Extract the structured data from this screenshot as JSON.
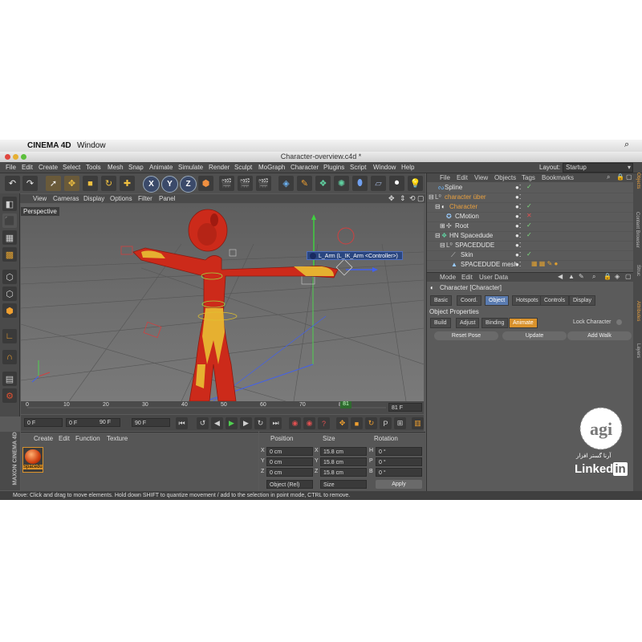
{
  "mac_menubar": {
    "apple": "",
    "app": "CINEMA 4D",
    "window": "Window"
  },
  "window": {
    "title": "Character-overview.c4d *"
  },
  "menu": [
    "File",
    "Edit",
    "Create",
    "Select",
    "Tools",
    "Mesh",
    "Snap",
    "Animate",
    "Simulate",
    "Render",
    "Sculpt",
    "MoGraph",
    "Character",
    "Plugins",
    "Script",
    "Window",
    "Help"
  ],
  "layout": {
    "label": "Layout:",
    "value": "Startup"
  },
  "viewport_menu": [
    "View",
    "Cameras",
    "Display",
    "Options",
    "Filter",
    "Panel"
  ],
  "viewport": {
    "name": "Perspective",
    "tooltip": "L_Arm (L_IK_Arm <Controller>)"
  },
  "timeline": {
    "ticks": [
      "0",
      "10",
      "20",
      "30",
      "40",
      "50",
      "60",
      "70",
      "80",
      "81 F"
    ],
    "current": "81"
  },
  "transport": {
    "start": "0 F",
    "min": "0 F",
    "max": "90 F",
    "end": "90 F"
  },
  "material_menu": [
    "Create",
    "Edit",
    "Function",
    "Texture"
  ],
  "material": {
    "name": "Spacedu"
  },
  "coords": {
    "headers": [
      "Position",
      "Size",
      "Rotation"
    ],
    "rows": [
      {
        "axis": "X",
        "pos": "0 cm",
        "size_axis": "X",
        "size": "15.8 cm",
        "rot_axis": "H",
        "rot": "0 °"
      },
      {
        "axis": "Y",
        "pos": "0 cm",
        "size_axis": "Y",
        "size": "15.8 cm",
        "rot_axis": "P",
        "rot": "0 °"
      },
      {
        "axis": "Z",
        "pos": "0 cm",
        "size_axis": "Z",
        "size": "15.8 cm",
        "rot_axis": "B",
        "rot": "0 °"
      }
    ],
    "mode": "Object (Rel)",
    "size_mode": "Size",
    "apply": "Apply"
  },
  "objects_menu": [
    "File",
    "Edit",
    "View",
    "Objects",
    "Tags",
    "Bookmarks"
  ],
  "objects": [
    {
      "name": "Spline",
      "indent": 1,
      "color": "#e4e4e4"
    },
    {
      "name": "character über",
      "indent": 0,
      "color": "#e8a040"
    },
    {
      "name": "Character",
      "indent": 1,
      "color": "#e8a040"
    },
    {
      "name": "CMotion",
      "indent": 2,
      "color": "#e4e4e4"
    },
    {
      "name": "Root",
      "indent": 2,
      "color": "#e4e4e4"
    },
    {
      "name": "HN Spacedude",
      "indent": 1,
      "color": "#e4e4e4"
    },
    {
      "name": "SPACEDUDE",
      "indent": 2,
      "color": "#e4e4e4"
    },
    {
      "name": "Skin",
      "indent": 3,
      "color": "#e4e4e4"
    },
    {
      "name": "SPACEDUDE mesh",
      "indent": 3,
      "color": "#e4e4e4"
    }
  ],
  "attributes_menu": [
    "Mode",
    "Edit",
    "User Data"
  ],
  "attributes": {
    "title": "Character [Character]",
    "tabs": [
      "Basic",
      "Coord.",
      "Object",
      "Hotspots",
      "Controls",
      "Display"
    ],
    "section": "Object Properties",
    "subtabs": [
      "Build",
      "Adjust",
      "Binding",
      "Animate"
    ],
    "lock_label": "Lock Character",
    "buttons": [
      "Reset Pose",
      "Update",
      "Add Walk"
    ]
  },
  "side_tabs": [
    "Objects",
    "Content Browser",
    "Struc",
    "Attributes",
    "Layers"
  ],
  "brand": {
    "maxon": "MAXON",
    "c4d": "CINEMA 4D",
    "watermark": "Linked in",
    "persian": "آرنا گستر افزار"
  },
  "status": "Move: Click and drag to move elements. Hold down SHIFT to quantize movement / add to the selection in point mode, CTRL to remove.",
  "colors": {
    "accent_orange": "#d9922c",
    "tab_blue": "#5a7bb0",
    "panel": "#5a5a5a",
    "character_red": "#cc2a1a",
    "character_yellow": "#e6b030"
  }
}
